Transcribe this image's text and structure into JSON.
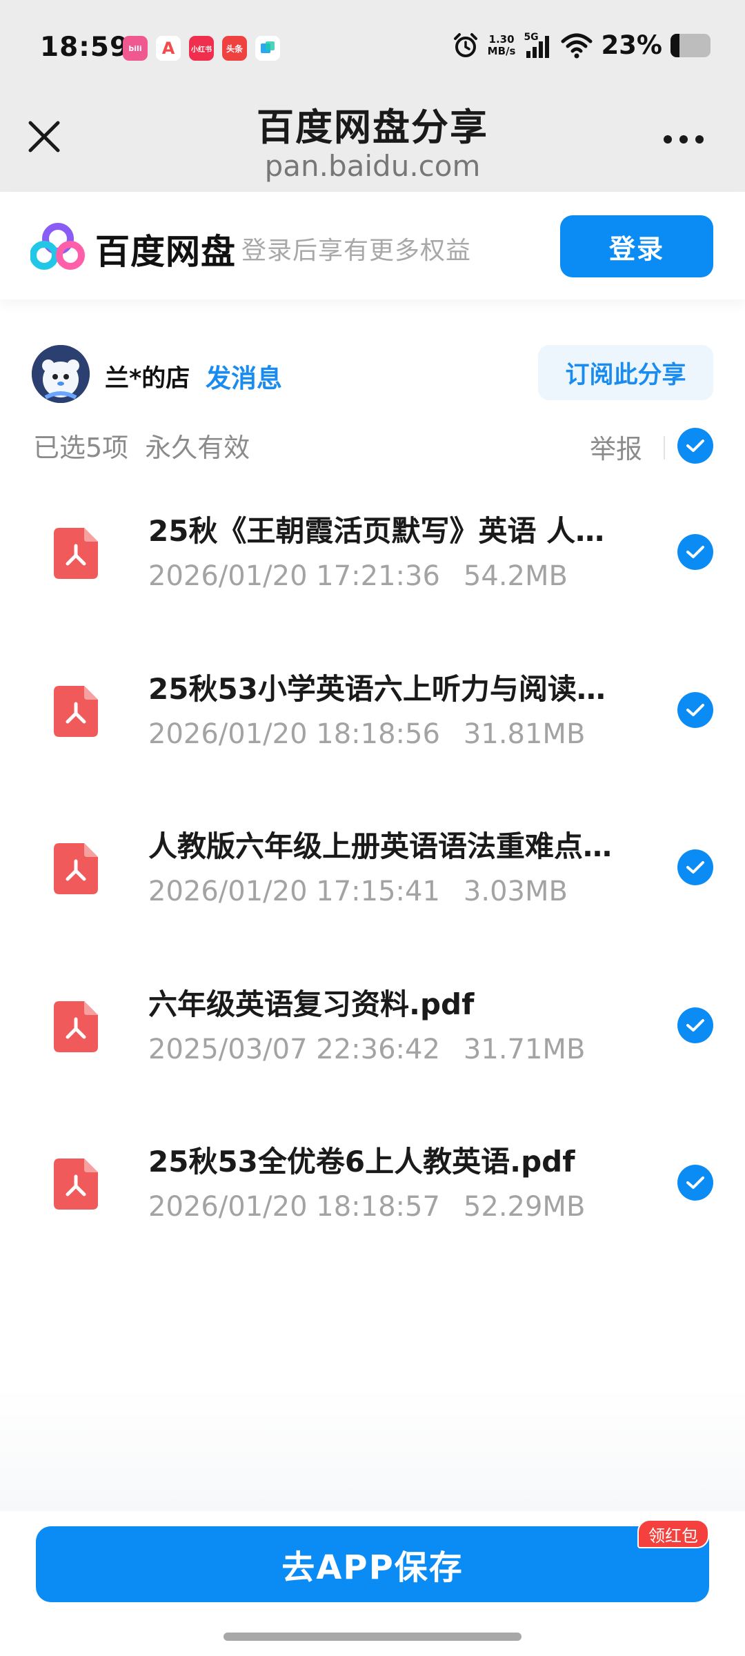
{
  "status_bar": {
    "time": "18:59",
    "app_icons": [
      {
        "name": "bilibili-icon",
        "label": "bili",
        "color": "#f0598f"
      },
      {
        "name": "app-a-icon",
        "label": "A",
        "color": "#f34b4b"
      },
      {
        "name": "xiaohongshu-icon",
        "label": "小红书",
        "color": "#ef2f4d"
      },
      {
        "name": "toutiao-icon",
        "label": "头条",
        "color": "#f04141"
      },
      {
        "name": "app-square-icon",
        "label": "",
        "color": "#2aa9f0"
      }
    ],
    "net_speed_value": "1.30",
    "net_speed_unit": "MB/s",
    "signal_label": "5G",
    "battery_percent": "23%",
    "battery_level": 0.23
  },
  "title_bar": {
    "title": "百度网盘分享",
    "url": "pan.baidu.com"
  },
  "brand": {
    "name": "百度网盘",
    "slogan": "登录后享有更多权益",
    "login_label": "登录",
    "accent": "#0b8cf5"
  },
  "share": {
    "owner": "兰*的店",
    "send_message": "发消息",
    "subscribe": "订阅此分享",
    "selected_count": "已选5项",
    "validity": "永久有效",
    "report": "举报"
  },
  "files": [
    {
      "name": "25秋《王朝霞活页默写》英语 人…",
      "date": "2026/01/20 17:21:36",
      "size": "54.2MB",
      "checked": true
    },
    {
      "name": "25秋53小学英语六上听力与阅读…",
      "date": "2026/01/20 18:18:56",
      "size": "31.81MB",
      "checked": true
    },
    {
      "name": "人教版六年级上册英语语法重难点…",
      "date": "2026/01/20 17:15:41",
      "size": "3.03MB",
      "checked": true
    },
    {
      "name": "六年级英语复习资料.pdf",
      "date": "2025/03/07 22:36:42",
      "size": "31.71MB",
      "checked": true
    },
    {
      "name": "25秋53全优卷6上人教英语.pdf",
      "date": "2026/01/20 18:18:57",
      "size": "52.29MB",
      "checked": true
    }
  ],
  "bottom": {
    "save_label": "去APP保存",
    "badge": "领红包"
  }
}
